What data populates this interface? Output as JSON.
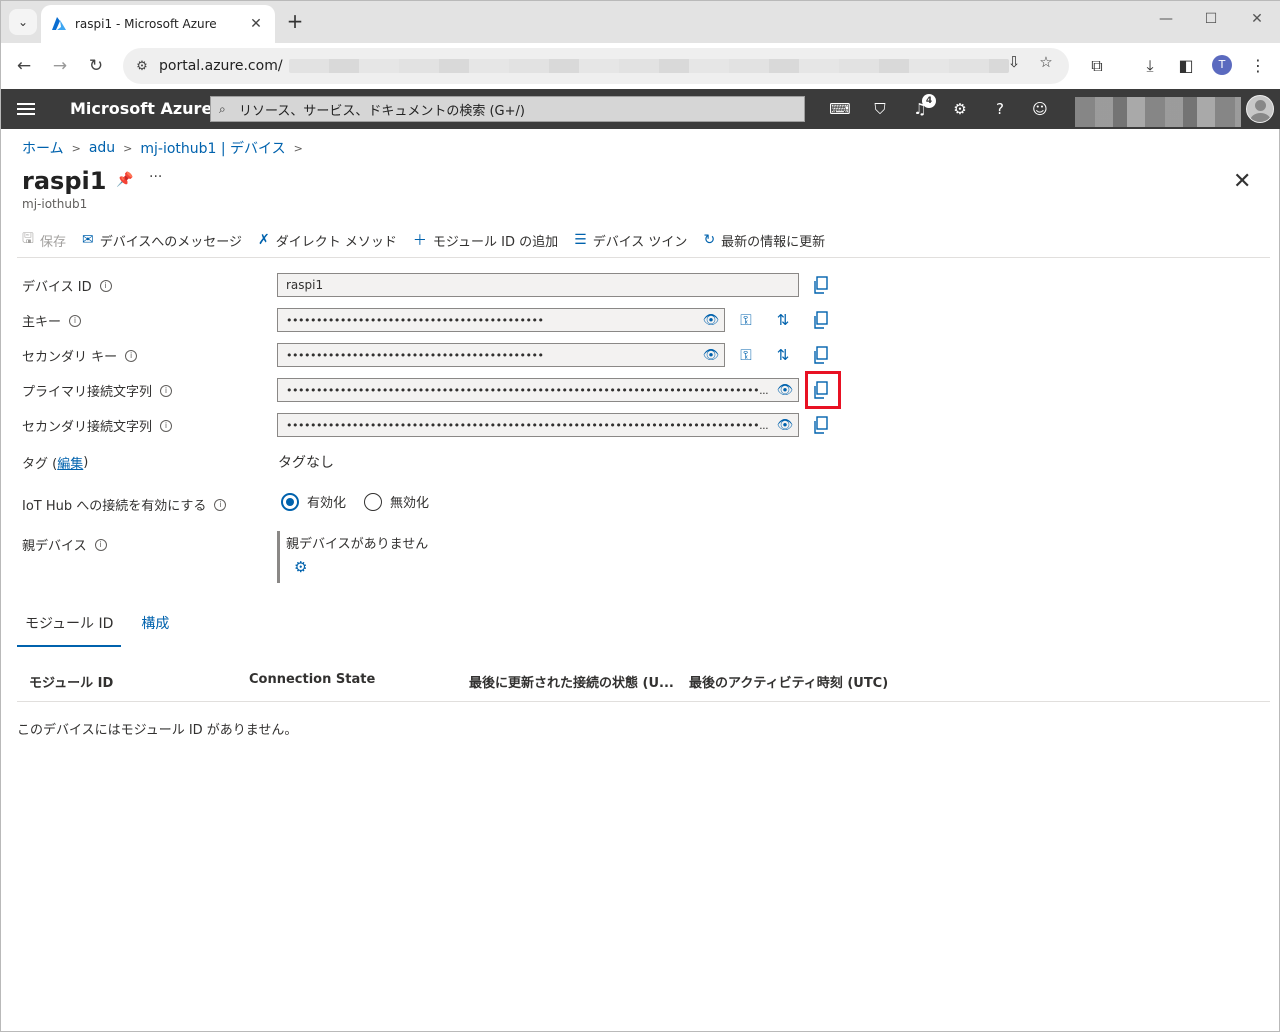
{
  "browser": {
    "tab_title": "raspi1 - Microsoft Azure",
    "url": "portal.azure.com/"
  },
  "azure": {
    "brand": "Microsoft Azure",
    "search_placeholder": "リソース、サービス、ドキュメントの検索 (G+/)",
    "notification_count": "4",
    "profile_initial": "T"
  },
  "breadcrumb": [
    "ホーム",
    "adu",
    "mj-iothub1 | デバイス"
  ],
  "page": {
    "title": "raspi1",
    "subtitle": "mj-iothub1"
  },
  "toolbar": {
    "save": "保存",
    "message": "デバイスへのメッセージ",
    "direct_method": "ダイレクト メソッド",
    "add_module": "モジュール ID の追加",
    "device_twin": "デバイス ツイン",
    "refresh": "最新の情報に更新"
  },
  "form": {
    "device_id_label": "デバイス ID",
    "device_id_value": "raspi1",
    "primary_key_label": "主キー",
    "primary_key_value": "•••••••••••••••••••••••••••••••••••••••••••",
    "secondary_key_label": "セカンダリ キー",
    "secondary_key_value": "•••••••••••••••••••••••••••••••••••••••••••",
    "primary_conn_label": "プライマリ接続文字列",
    "primary_conn_value": "•••••••••••••••••••••••••••••••••••••••••••••••••••••••••••••••••••••••••••••••...",
    "secondary_conn_label": "セカンダリ接続文字列",
    "secondary_conn_value": "•••••••••••••••••••••••••••••••••••••••••••••••••••••••••••••••••••••••••••••••...",
    "tags_label": "タグ (",
    "tags_edit": "編集",
    "tags_close": ")",
    "tags_value": "タグなし",
    "iot_conn_label": "IoT Hub への接続を有効にする",
    "enable": "有効化",
    "disable": "無効化",
    "parent_label": "親デバイス",
    "parent_value": "親デバイスがありません"
  },
  "tabs": [
    "モジュール ID",
    "構成"
  ],
  "table": {
    "columns": [
      "モジュール ID",
      "Connection State",
      "最後に更新された接続の状態 (U...",
      "最後のアクティビティ時刻 (UTC)"
    ],
    "empty_message": "このデバイスにはモジュール ID がありません。"
  }
}
